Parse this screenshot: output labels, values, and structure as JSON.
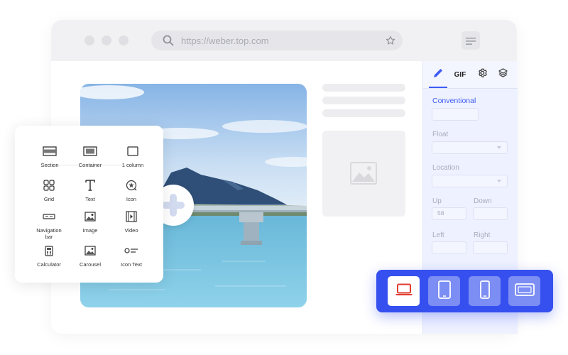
{
  "browser": {
    "url": "https://weber.top.com",
    "search_icon": "search-icon",
    "bookmark_icon": "star-icon",
    "menu_icon": "hamburger-icon"
  },
  "canvas": {
    "photo_subject": "lake-bridge-mountain"
  },
  "widgets_panel": {
    "items": [
      {
        "label": "Section",
        "icon": "section-icon"
      },
      {
        "label": "Container",
        "icon": "container-icon"
      },
      {
        "label": "1 column",
        "icon": "one-column-icon"
      },
      {
        "label": "Grid",
        "icon": "grid-icon"
      },
      {
        "label": "Text",
        "icon": "text-icon"
      },
      {
        "label": "Icon",
        "icon": "icon-widget-icon"
      },
      {
        "label": "Navigation bar",
        "icon": "navigation-bar-icon"
      },
      {
        "label": "Image",
        "icon": "image-icon"
      },
      {
        "label": "Video",
        "icon": "video-icon"
      },
      {
        "label": "Calculator",
        "icon": "calculator-icon"
      },
      {
        "label": "Carousel",
        "icon": "carousel-icon"
      },
      {
        "label": "Icon Text",
        "icon": "icon-text-icon"
      }
    ]
  },
  "properties_panel": {
    "tabs": [
      {
        "name": "style",
        "icon": "pencil-icon",
        "active": true
      },
      {
        "name": "gif",
        "label": "GIF"
      },
      {
        "name": "settings",
        "icon": "gear-icon"
      },
      {
        "name": "layers",
        "icon": "layers-icon"
      }
    ],
    "section_title": "Conventional",
    "fields": {
      "float_label": "Float",
      "location_label": "Location",
      "up_label": "Up",
      "up_value": "58",
      "down_label": "Down",
      "left_label": "Left",
      "right_label": "Right"
    },
    "accent": "#3d5bf5"
  },
  "device_bar": {
    "background": "#3650ef",
    "active_color": "#e03c31",
    "devices": [
      {
        "name": "laptop",
        "icon": "laptop-icon",
        "active": true
      },
      {
        "name": "tablet",
        "icon": "tablet-icon",
        "active": false
      },
      {
        "name": "phone",
        "icon": "phone-icon",
        "active": false
      },
      {
        "name": "tablet-landscape",
        "icon": "tablet-landscape-icon",
        "active": false
      }
    ]
  }
}
